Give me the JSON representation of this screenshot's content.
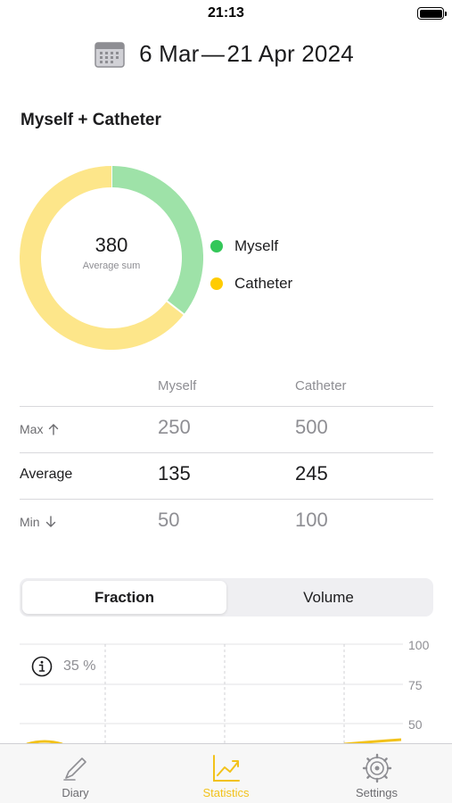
{
  "status_bar": {
    "time": "21:13"
  },
  "header": {
    "date_range": "6 Mar — 21 Apr 2024",
    "icon": "calendar-icon"
  },
  "section": {
    "title": "Myself + Catheter"
  },
  "donut": {
    "center_value": "380",
    "center_label": "Average sum",
    "slices": [
      {
        "name": "Myself",
        "value": 135,
        "color": "#9ee2a8"
      },
      {
        "name": "Catheter",
        "value": 245,
        "color": "#fde68a"
      }
    ]
  },
  "legend": [
    {
      "label": "Myself",
      "color": "#34c759"
    },
    {
      "label": "Catheter",
      "color": "#ffcc00"
    }
  ],
  "stats_table": {
    "columns": [
      "Myself",
      "Catheter"
    ],
    "rows": [
      {
        "label": "Max",
        "icon": "arrow-up-icon",
        "values": [
          "250",
          "500"
        ],
        "emphasis": false
      },
      {
        "label": "Average",
        "icon": "",
        "values": [
          "135",
          "245"
        ],
        "emphasis": true
      },
      {
        "label": "Min",
        "icon": "arrow-down-icon",
        "values": [
          "50",
          "100"
        ],
        "emphasis": false
      }
    ]
  },
  "segmented": {
    "options": [
      "Fraction",
      "Volume"
    ],
    "selected": "Fraction"
  },
  "chart_data": {
    "type": "area",
    "y_ticks": [
      "100",
      "75",
      "50"
    ],
    "ylim": [
      0,
      100
    ],
    "info_label": "35 %",
    "grid": true
  },
  "tab_bar": {
    "items": [
      {
        "label": "Diary",
        "icon": "pencil-icon",
        "active": false
      },
      {
        "label": "Statistics",
        "icon": "chart-icon",
        "active": true
      },
      {
        "label": "Settings",
        "icon": "gear-icon",
        "active": false
      }
    ],
    "active_color": "#f2c21b"
  }
}
